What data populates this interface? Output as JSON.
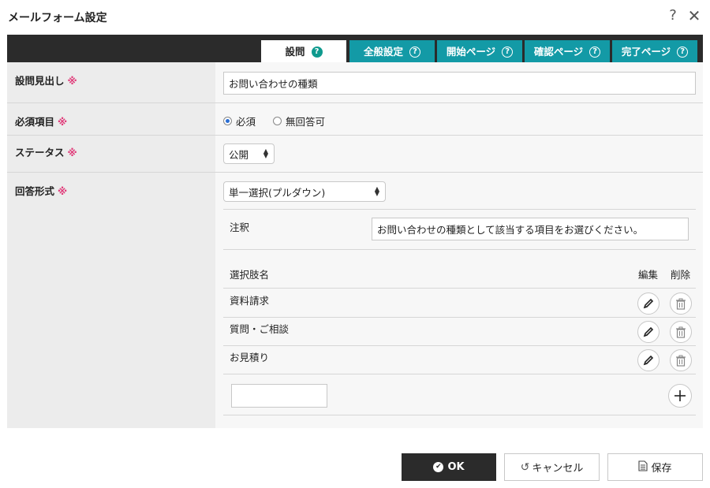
{
  "window": {
    "title": "メールフォーム設定",
    "help_glyph": "?",
    "close_glyph": "✕"
  },
  "tabs": [
    {
      "label": "設問",
      "active": true
    },
    {
      "label": "全般設定",
      "active": false
    },
    {
      "label": "開始ページ",
      "active": false
    },
    {
      "label": "確認ページ",
      "active": false
    },
    {
      "label": "完了ページ",
      "active": false
    }
  ],
  "required_mark": "※",
  "fields": {
    "heading": {
      "label": "設問見出し",
      "value": "お問い合わせの種類"
    },
    "required": {
      "label": "必須項目",
      "options": [
        "必須",
        "無回答可"
      ],
      "selected": "必須"
    },
    "status": {
      "label": "ステータス",
      "value": "公開"
    },
    "answer_type": {
      "label": "回答形式",
      "value": "単一選択(プルダウン)"
    }
  },
  "note": {
    "label": "注釈",
    "value": "お問い合わせの種類として該当する項目をお選びください。"
  },
  "choices": {
    "header_name": "選択肢名",
    "header_edit": "編集",
    "header_delete": "削除",
    "items": [
      "資料請求",
      "質問・ご相談",
      "お見積り"
    ],
    "new_item_value": ""
  },
  "footer": {
    "ok": "OK",
    "cancel": "キャンセル",
    "save": "保存"
  },
  "colors": {
    "tab_active_bg": "#ffffff",
    "tab_bg": "#139aa6",
    "tabbar_bg": "#2b2b2b",
    "required_mark": "#e03c7a",
    "radio_checked": "#2a6ed4",
    "ok_bg": "#2b2b2b"
  }
}
